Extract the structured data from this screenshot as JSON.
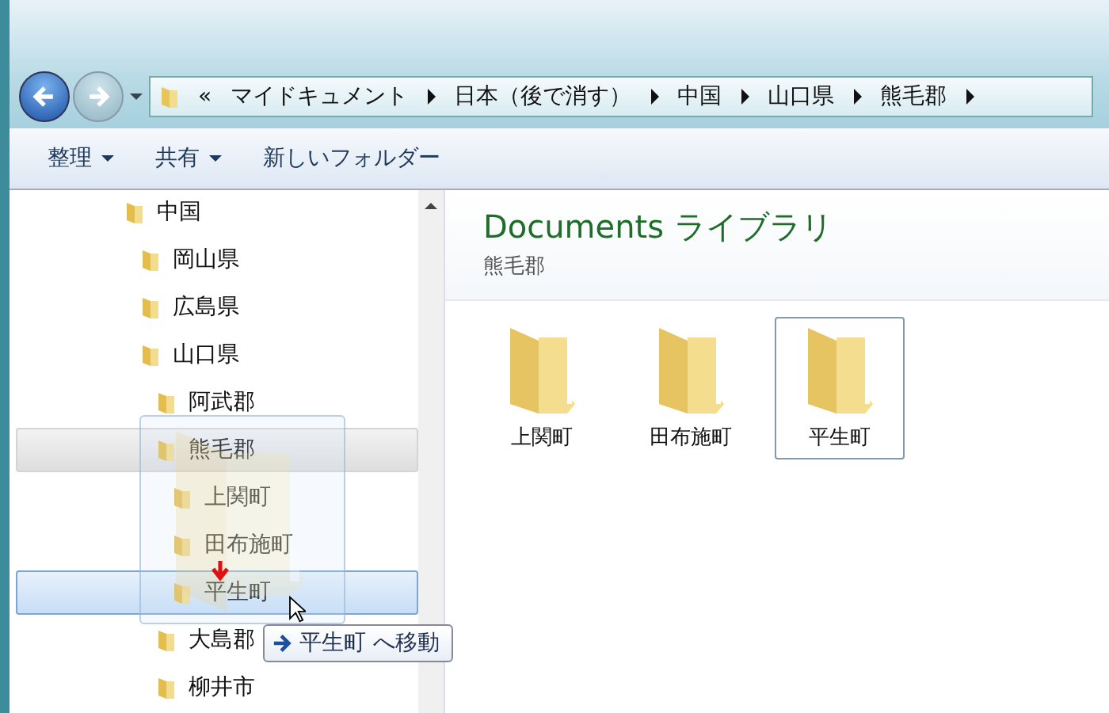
{
  "address_bar": {
    "overflow": "«",
    "crumbs": [
      "マイドキュメント",
      "日本（後で消す）",
      "中国",
      "山口県",
      "熊毛郡"
    ]
  },
  "toolbar": [
    {
      "label": "整理",
      "kind": "menu"
    },
    {
      "label": "共有",
      "kind": "menu"
    },
    {
      "label": "新しいフォルダー",
      "kind": "plain"
    }
  ],
  "tree": [
    {
      "label": "中国",
      "selected": false,
      "drop_target": false,
      "children": [
        {
          "label": "岡山県",
          "selected": false,
          "drop_target": false
        },
        {
          "label": "広島県",
          "selected": false,
          "drop_target": false
        },
        {
          "label": "山口県",
          "selected": false,
          "drop_target": false,
          "children": [
            {
              "label": "阿武郡",
              "selected": false,
              "drop_target": false
            },
            {
              "label": "熊毛郡",
              "selected": true,
              "drop_target": false,
              "children": [
                {
                  "label": "上関町",
                  "selected": false,
                  "drop_target": false
                },
                {
                  "label": "田布施町",
                  "selected": false,
                  "drop_target": false
                },
                {
                  "label": "平生町",
                  "selected": false,
                  "drop_target": true
                }
              ]
            },
            {
              "label": "大島郡",
              "selected": false,
              "drop_target": false
            },
            {
              "label": "柳井市",
              "selected": false,
              "drop_target": false
            }
          ]
        }
      ]
    }
  ],
  "library": {
    "title": "Documents ライブラリ",
    "subtitle": "熊毛郡"
  },
  "files": [
    {
      "label": "上関町",
      "selected": false
    },
    {
      "label": "田布施町",
      "selected": false
    },
    {
      "label": "平生町",
      "selected": true
    }
  ],
  "drag_tooltip": {
    "target": "平生町",
    "action": "へ移動"
  }
}
